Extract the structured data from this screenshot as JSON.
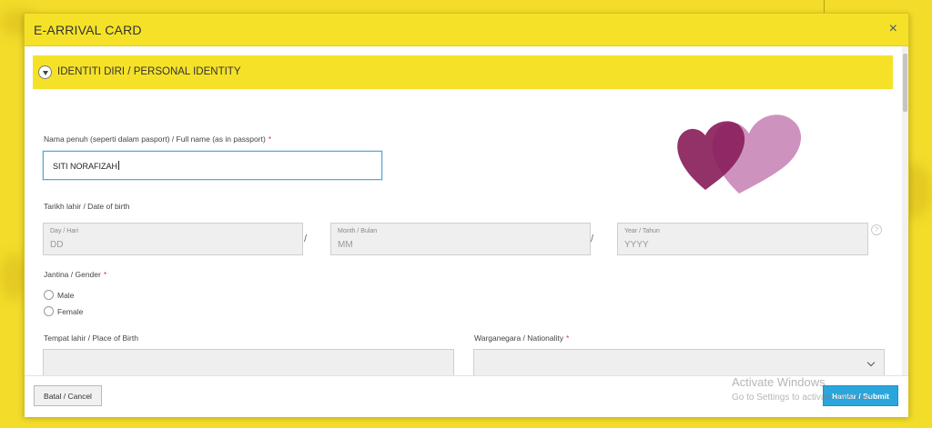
{
  "modal": {
    "title": "E-ARRIVAL CARD",
    "close_glyph": "×"
  },
  "section": {
    "title": "IDENTITI DIRI / PERSONAL IDENTITY",
    "toggle_icon": "chevron-down-icon"
  },
  "fields": {
    "full_name": {
      "label": "Nama penuh (seperti dalam pasport) / Full name (as in passport)",
      "required_mark": "*",
      "value": "SITI NORAFIZAH"
    },
    "dob": {
      "label": "Tarikh lahir / Date of birth",
      "day_label": "Day / Hari",
      "day_placeholder": "DD",
      "month_label": "Month / Bulan",
      "month_placeholder": "MM",
      "year_label": "Year / Tahun",
      "year_placeholder": "YYYY",
      "separator": "/",
      "help_glyph": "?"
    },
    "gender": {
      "label": "Jantina / Gender",
      "required_mark": "*",
      "options": [
        "Male",
        "Female"
      ]
    },
    "place_of_birth": {
      "label": "Tempat lahir / Place of Birth",
      "value": ""
    },
    "nationality": {
      "label": "Warganegara / Nationality",
      "required_mark": "*",
      "value": ""
    }
  },
  "footer": {
    "cancel_label": "Batal / Cancel",
    "submit_label": "Hantar / Submit"
  },
  "watermark": {
    "line1": "Activate Windows",
    "line2": "Go to Settings to activate Windows."
  },
  "colors": {
    "accent_yellow": "#f5e228",
    "submit_blue": "#2aa6dd",
    "heart_dark": "#8a1f5c",
    "heart_light": "#c57fb3"
  }
}
